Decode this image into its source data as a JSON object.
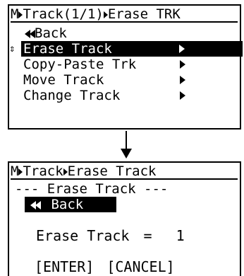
{
  "screen1": {
    "title_prefix": "M",
    "title_a": "Track(1/1)",
    "title_b": "Erase TRK",
    "back_label": "Back",
    "items": [
      {
        "label": "Erase Track"
      },
      {
        "label": "Copy-Paste Trk"
      },
      {
        "label": "Move Track"
      },
      {
        "label": "Change Track"
      }
    ]
  },
  "screen2": {
    "title_prefix": "M",
    "title_a": "Track",
    "title_b": "Erase Track",
    "header": "--- Erase Track ---",
    "back_label": "Back",
    "field_label": "Erase Track",
    "equals": "=",
    "field_value": "1",
    "enter_label": "[ENTER]",
    "cancel_label": "[CANCEL]"
  }
}
